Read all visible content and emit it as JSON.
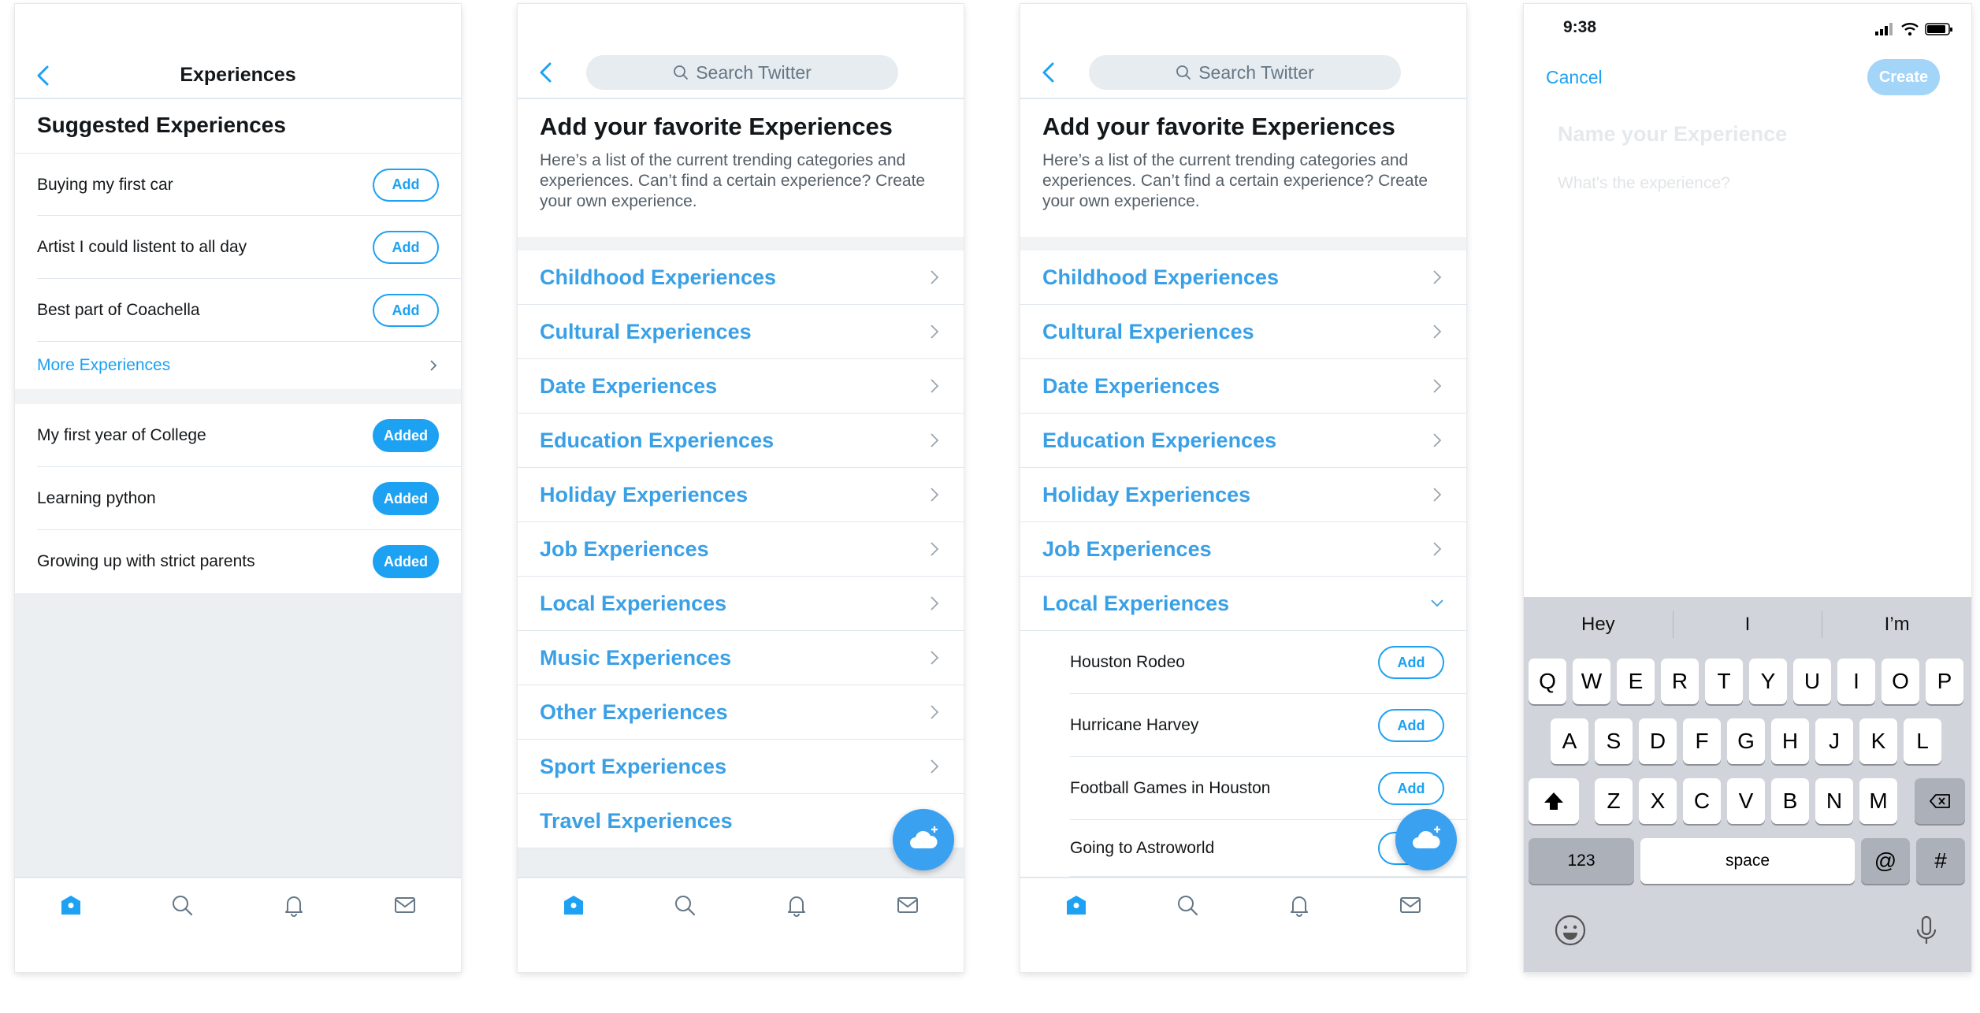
{
  "screen1": {
    "title": "Experiences",
    "section_title": "Suggested Experiences",
    "suggested": [
      {
        "label": "Buying my first car",
        "button": "Add"
      },
      {
        "label": "Artist I could listent to all day",
        "button": "Add"
      },
      {
        "label": "Best part of Coachella",
        "button": "Add"
      }
    ],
    "more_label": "More Experiences",
    "added": [
      {
        "label": "My first year of College",
        "button": "Added"
      },
      {
        "label": "Learning python",
        "button": "Added"
      },
      {
        "label": "Growing up with strict parents",
        "button": "Added"
      }
    ]
  },
  "search_placeholder": "Search Twitter",
  "intro": {
    "title": "Add your favorite Experiences",
    "description": "Here’s a list of the current trending categories and experiences. Can’t find a certain experience? Create your own experience."
  },
  "categories": [
    "Childhood Experiences",
    "Cultural Experiences",
    "Date Experiences",
    "Education Experiences",
    "Holiday Experiences",
    "Job Experiences",
    "Local Experiences",
    "Music Experiences",
    "Other Experiences",
    "Sport Experiences",
    "Travel Experiences"
  ],
  "local_items": [
    {
      "label": "Houston Rodeo",
      "button": "Add"
    },
    {
      "label": "Hurricane Harvey",
      "button": "Add"
    },
    {
      "label": "Football Games in Houston",
      "button": "Add"
    },
    {
      "label": "Going to Astroworld",
      "button": "Add"
    }
  ],
  "tabs": [
    "home-icon",
    "search-icon",
    "bell-icon",
    "mail-icon"
  ],
  "screen4": {
    "time": "9:38",
    "cancel": "Cancel",
    "create": "Create",
    "name_placeholder": "Name your Experience",
    "desc_placeholder": "What's the experience?"
  },
  "keyboard": {
    "predictions": [
      "Hey",
      "I",
      "I’m"
    ],
    "row1": [
      "Q",
      "W",
      "E",
      "R",
      "T",
      "Y",
      "U",
      "I",
      "O",
      "P"
    ],
    "row2": [
      "A",
      "S",
      "D",
      "F",
      "G",
      "H",
      "J",
      "K",
      "L"
    ],
    "row3": [
      "Z",
      "X",
      "C",
      "V",
      "B",
      "N",
      "M"
    ],
    "numbers": "123",
    "space": "space",
    "at": "@",
    "hash": "#"
  },
  "colors": {
    "accent": "#1da1f2",
    "category": "#3aa0e6",
    "divider": "#e1e8ed"
  }
}
